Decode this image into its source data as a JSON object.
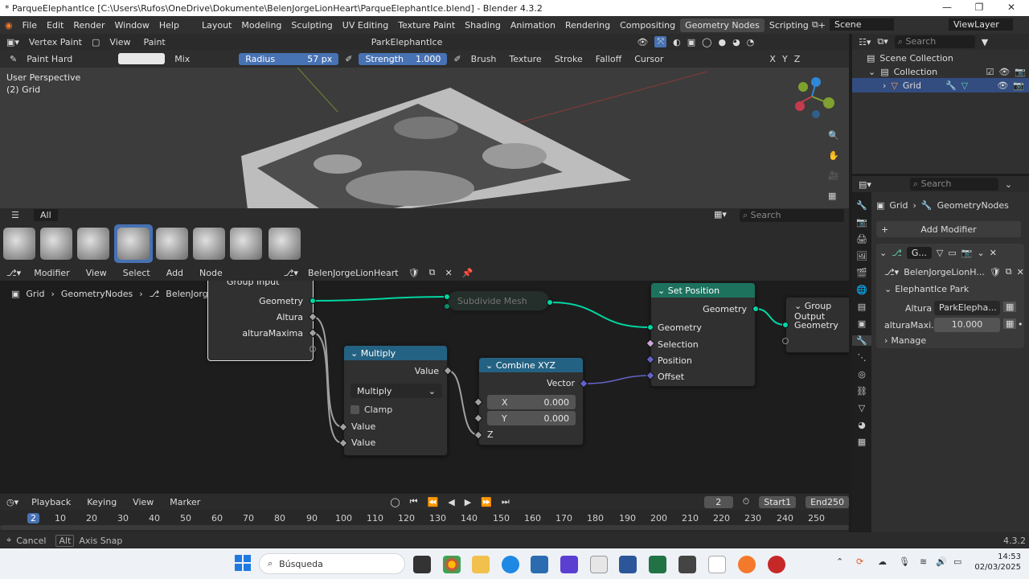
{
  "window": {
    "title": "* ParqueElephantIce [C:\\Users\\Rufos\\OneDrive\\Dokumente\\BelenJorgeLionHeart\\ParqueElephantIce.blend] - Blender 4.3.2"
  },
  "menu": [
    "File",
    "Edit",
    "Render",
    "Window",
    "Help"
  ],
  "workspaces": [
    "Layout",
    "Modeling",
    "Sculpting",
    "UV Editing",
    "Texture Paint",
    "Shading",
    "Animation",
    "Rendering",
    "Compositing",
    "Geometry Nodes",
    "Scripting"
  ],
  "active_workspace": "Geometry Nodes",
  "scene": "Scene",
  "view_layer": "ViewLayer",
  "viewport_header": {
    "mode": "Vertex Paint",
    "view": "View",
    "paint": "Paint",
    "object": "ParkElephantIce"
  },
  "tool_header": {
    "brush": "Paint Hard",
    "blend": "Mix",
    "radius_label": "Radius",
    "radius_value": "57 px",
    "strength_label": "Strength",
    "strength_value": "1.000",
    "menus": [
      "Brush",
      "Texture",
      "Stroke",
      "Falloff",
      "Cursor"
    ],
    "axes": [
      "X",
      "Y",
      "Z"
    ]
  },
  "viewport": {
    "perspective": "User Perspective",
    "object_label": "(2) Grid"
  },
  "asset_shelf": {
    "tab": "All",
    "search_placeholder": "Search"
  },
  "node_editor": {
    "header": {
      "type": "Modifier",
      "menus": [
        "View",
        "Select",
        "Add",
        "Node"
      ],
      "tree": "BelenJorgeLionHeart"
    },
    "breadcrumb": [
      "Grid",
      "GeometryNodes",
      "BelenJorgeLionHeart"
    ],
    "nodes": {
      "group_input": {
        "title": "Group Input",
        "outputs": [
          "Geometry",
          "Altura",
          "alturaMaxima"
        ]
      },
      "subdivide": {
        "title": "Subdivide Mesh"
      },
      "multiply": {
        "title": "Multiply",
        "output": "Value",
        "operation": "Multiply",
        "clamp": "Clamp",
        "inputs": [
          "Value",
          "Value"
        ]
      },
      "combine": {
        "title": "Combine XYZ",
        "output": "Vector",
        "x_label": "X",
        "x_value": "0.000",
        "y_label": "Y",
        "y_value": "0.000",
        "z_label": "Z"
      },
      "set_position": {
        "title": "Set Position",
        "output": "Geometry",
        "inputs": [
          "Geometry",
          "Selection",
          "Position",
          "Offset"
        ]
      },
      "group_output": {
        "title": "Group Output",
        "input": "Geometry"
      }
    }
  },
  "timeline": {
    "menus": [
      "Playback",
      "Keying",
      "View",
      "Marker"
    ],
    "current_frame": "2",
    "start_label": "Start",
    "start": "1",
    "end_label": "End",
    "end": "250",
    "ticks": [
      "2",
      "10",
      "20",
      "30",
      "40",
      "50",
      "60",
      "70",
      "80",
      "90",
      "100",
      "110",
      "120",
      "130",
      "140",
      "150",
      "160",
      "170",
      "180",
      "190",
      "200",
      "210",
      "220",
      "230",
      "240",
      "250"
    ]
  },
  "status": {
    "cancel": "Cancel",
    "alt": "Alt",
    "axis_snap": "Axis Snap",
    "version": "4.3.2"
  },
  "outliner": {
    "search_placeholder": "Search",
    "scene_collection": "Scene Collection",
    "collection": "Collection",
    "object": "Grid"
  },
  "properties": {
    "search_placeholder": "Search",
    "breadcrumb_object": "Grid",
    "breadcrumb_modifier": "GeometryNodes",
    "add_modifier": "Add Modifier",
    "modifier_short": "G...",
    "node_group": "BelenJorgeLionH...",
    "panel_name": "ElephantIce Park",
    "altura_label": "Altura",
    "altura_value": "ParkElepha...",
    "altmax_label": "alturaMaxi...",
    "altmax_value": "10.000",
    "manage": "Manage"
  },
  "taskbar": {
    "search": "Búsqueda",
    "time": "14:53",
    "date": "02/03/2025"
  },
  "colors": {
    "geometry_socket": "#00d6a3",
    "header_math": "#246283",
    "header_vector": "#246283",
    "header_geo": "#1d725e",
    "accent_blue": "#4772b3"
  }
}
